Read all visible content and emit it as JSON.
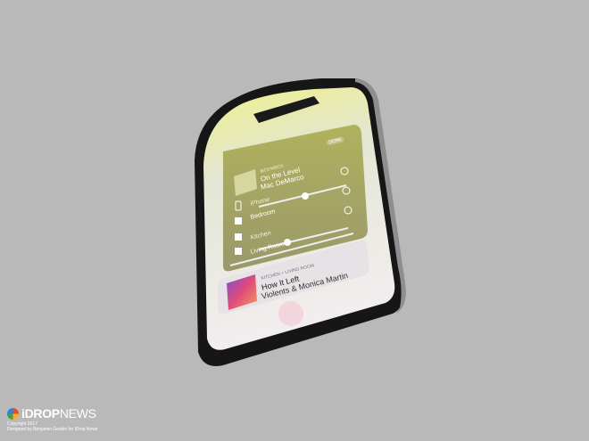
{
  "photo": {
    "description_icons": [
      "airplay-device-icon",
      "speaker-icon",
      "iphone-icon"
    ]
  },
  "now_playing_top": {
    "source_label": "iBOOMBOX",
    "done_label": "DONE",
    "title": "On the Level",
    "artist": "Mac DeMarco"
  },
  "devices": [
    {
      "label": "iPhone"
    },
    {
      "label": "Bedroom"
    },
    {
      "label": "Kitchen"
    },
    {
      "label": "Living Room"
    }
  ],
  "now_playing_bottom": {
    "route_label": "KITCHEN + LIVING ROOM",
    "title": "How It Left",
    "artist": "Violents & Monica Martin"
  },
  "branding": {
    "logo_bold": "iDROP",
    "logo_thin": "NEWS",
    "copyright_line1": "Copyright 2017",
    "copyright_line2": "Designed by Benjamin Geskin for iDrop News"
  },
  "colors": {
    "background": "#b9b9b9",
    "screen_glow": "#e9e86a",
    "phone_frame": "#1a1a1a"
  }
}
